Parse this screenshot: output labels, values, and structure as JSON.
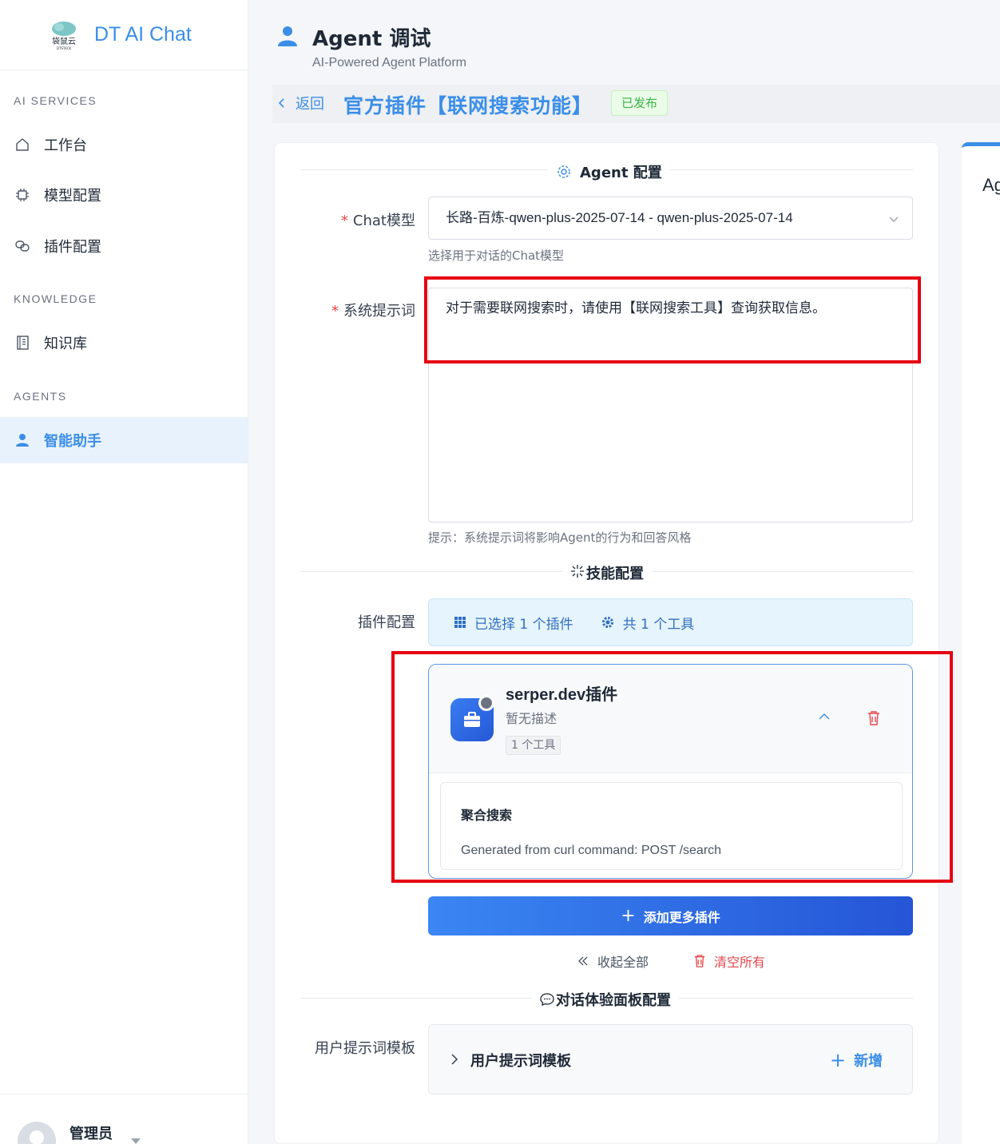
{
  "app": {
    "logo_text": "袋鼠云",
    "logo_sub": "DTSTACK",
    "title": "DT AI Chat"
  },
  "sidebar": {
    "sections": [
      {
        "label": "AI SERVICES"
      },
      {
        "label": "KNOWLEDGE"
      },
      {
        "label": "AGENTS"
      }
    ],
    "items": [
      {
        "label": "工作台",
        "icon": "home-icon"
      },
      {
        "label": "模型配置",
        "icon": "chip-icon"
      },
      {
        "label": "插件配置",
        "icon": "link-icon"
      },
      {
        "label": "知识库",
        "icon": "book-icon"
      },
      {
        "label": "智能助手",
        "icon": "user-icon",
        "active": true
      }
    ],
    "user": {
      "name": "管理员"
    }
  },
  "header": {
    "title": "Agent 调试",
    "subtitle": "AI-Powered Agent Platform"
  },
  "breadcrumb": {
    "back_label": "返回",
    "plugin_title": "官方插件【联网搜索功能】",
    "status": "已发布"
  },
  "form": {
    "agent_section": "Agent 配置",
    "chat_model": {
      "label": "Chat模型",
      "value": "长路-百炼-qwen-plus-2025-07-14 - qwen-plus-2025-07-14",
      "hint": "选择用于对话的Chat模型"
    },
    "system_prompt": {
      "label": "系统提示词",
      "value": "对于需要联网搜索时，请使用【联网搜索工具】查询获取信息。",
      "hint": "提示：系统提示词将影响Agent的行为和回答风格"
    },
    "skills_section": "技能配置",
    "plugin_config": {
      "label": "插件配置",
      "selected_plugins": "已选择 1 个插件",
      "total_tools": "共 1 个工具"
    },
    "plugin": {
      "name": "serper.dev插件",
      "description": "暂无描述",
      "tool_count": "1 个工具",
      "tools": [
        {
          "name": "聚合搜索",
          "description": "Generated from curl command: POST /search"
        }
      ]
    },
    "add_more_plugins": "添加更多插件",
    "collapse_all": "收起全部",
    "clear_all": "清空所有",
    "chat_panel_section": "对话体验面板配置",
    "user_prompt_template": {
      "label": "用户提示词模板",
      "title": "用户提示词模板",
      "add_label": "新增"
    }
  },
  "right_panel": {
    "title_partial": "Ag"
  },
  "colors": {
    "accent": "#3b8ee8",
    "success": "#3bb54a",
    "danger": "#e5484d",
    "highlight_box": "#e60012"
  }
}
